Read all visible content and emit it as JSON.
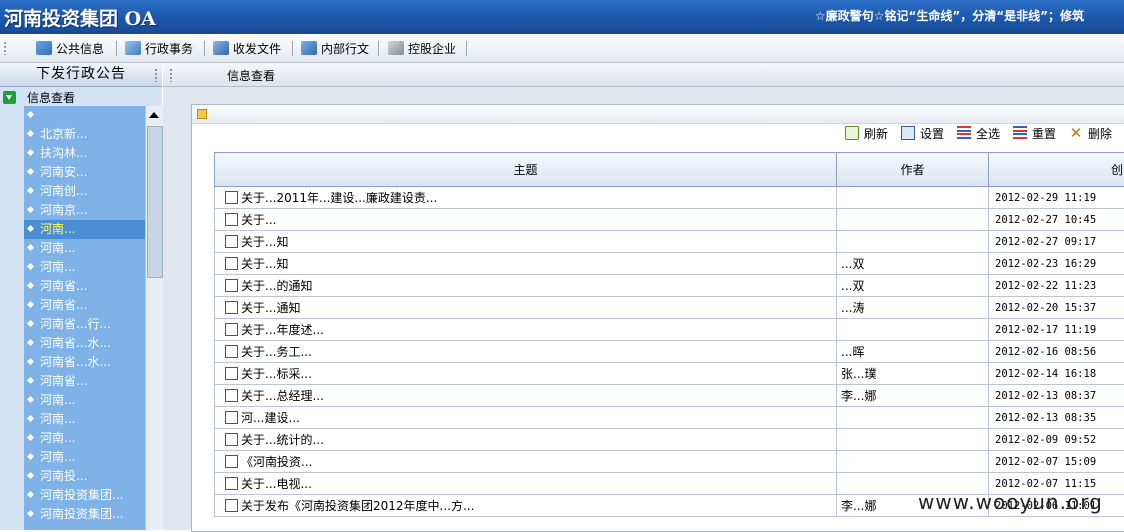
{
  "header": {
    "title": "河南投资集团 OA",
    "slogan": "☆廉政警句☆铭记“生命线”，分清“是非线”；修筑"
  },
  "toolbar": {
    "items": [
      "公共信息",
      "行政事务",
      "收发文件",
      "内部行文",
      "控股企业"
    ]
  },
  "left_panel": {
    "title": "下发行政公告",
    "tree_root": "信息查看",
    "items": [
      "",
      "北京新...",
      "扶沟林...",
      "河南安...",
      "河南创...",
      "河南京...",
      "河南...",
      "河南...",
      "河南...",
      "河南省...",
      "河南省...",
      "河南省...行...",
      "河南省...水...",
      "河南省...水...",
      "河南省...",
      "河南...",
      "河南...",
      "河南...",
      "河南...",
      "河南投...",
      "河南投资集团...",
      "河南投资集团..."
    ],
    "selected_index": 6
  },
  "main": {
    "tab_title": "信息查看",
    "actions": [
      "刷新",
      "设置",
      "全选",
      "重置",
      "删除"
    ],
    "table": {
      "columns": [
        "主题",
        "作者",
        "创"
      ],
      "rows": [
        {
          "subject": "关于...2011年...建设...廉政建设责...",
          "author": "",
          "date": "2012-02-29 11:19"
        },
        {
          "subject": "关于...",
          "author": "",
          "date": "2012-02-27 10:45"
        },
        {
          "subject": "关于...知",
          "author": "",
          "date": "2012-02-27 09:17"
        },
        {
          "subject": "关于...知",
          "author": "...双",
          "date": "2012-02-23 16:29"
        },
        {
          "subject": "关于...的通知",
          "author": "...双",
          "date": "2012-02-22 11:23"
        },
        {
          "subject": "关于...通知",
          "author": "...涛",
          "date": "2012-02-20 15:37"
        },
        {
          "subject": "关于...年度述...",
          "author": "",
          "date": "2012-02-17 11:19"
        },
        {
          "subject": "关于...务工...",
          "author": "...晖",
          "date": "2012-02-16 08:56"
        },
        {
          "subject": "关于...标采...",
          "author": "张...璞",
          "date": "2012-02-14 16:18"
        },
        {
          "subject": "关于...总经理...",
          "author": "李...娜",
          "date": "2012-02-13 08:37"
        },
        {
          "subject": "河...建设...",
          "author": "",
          "date": "2012-02-13 08:35"
        },
        {
          "subject": "关于...统计的...",
          "author": "",
          "date": "2012-02-09 09:52"
        },
        {
          "subject": "《河南投资...",
          "author": "",
          "date": "2012-02-07 15:09"
        },
        {
          "subject": "关于...电视...",
          "author": "",
          "date": "2012-02-07 11:15"
        },
        {
          "subject": "关于发布《河南投资集团2012年度中...方...",
          "author": "李...娜",
          "date": "2012-02-06 11:01"
        }
      ]
    }
  },
  "watermark": "www.wooyun.org",
  "colors": {
    "header_blue": "#1c55a8",
    "tree_blue": "#7fb3e8",
    "selected_text": "#ffff66"
  }
}
